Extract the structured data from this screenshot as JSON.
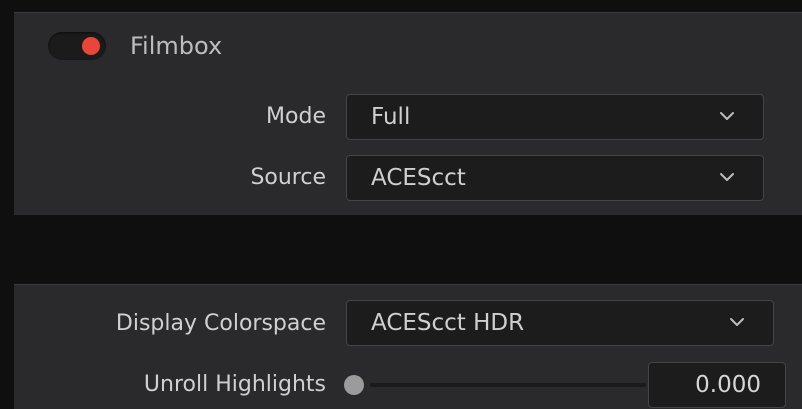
{
  "filmbox": {
    "enabled": true,
    "toggle_color": "#e8463a",
    "title": "Filmbox",
    "mode": {
      "label": "Mode",
      "value": "Full"
    },
    "source": {
      "label": "Source",
      "value": "ACEScct"
    }
  },
  "display": {
    "colorspace": {
      "label": "Display Colorspace",
      "value": "ACEScct HDR"
    },
    "unroll_highlights": {
      "label": "Unroll Highlights",
      "value": "0.000",
      "fraction": 0.0
    }
  },
  "icons": {
    "dropdown": "chevron-down-icon"
  }
}
